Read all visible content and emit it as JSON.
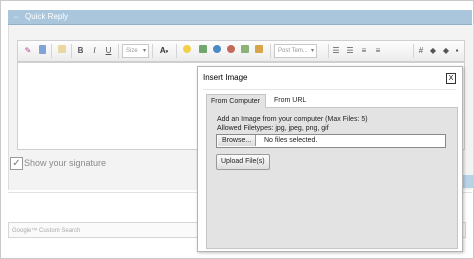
{
  "quick_reply": {
    "title": "Quick Reply",
    "collapse_glyph": "−"
  },
  "toolbar": {
    "font_size_placeholder": "Size",
    "post_template_placeholder": "Post Tem...",
    "bold": "B",
    "italic": "I",
    "underline": "U",
    "font_color": "A",
    "dropdown_arrow": "▾"
  },
  "signature": {
    "label": "Show your signature",
    "checked": true,
    "check_glyph": "✓"
  },
  "google_search": {
    "placeholder": "Google™ Custom Search"
  },
  "dialog": {
    "title": "Insert Image",
    "close": "X",
    "tabs": [
      "From Computer",
      "From URL"
    ],
    "description": "Add an Image from your computer (Max Files: 5)",
    "allowed": "Allowed Filetypes: jpg, jpeg, png, gif",
    "browse_label": "Browse...",
    "file_status": "No files selected.",
    "upload_label": "Upload File(s)"
  },
  "colors": {
    "header_bar": "#a9c6dc",
    "panel": "#e3e3e3"
  }
}
